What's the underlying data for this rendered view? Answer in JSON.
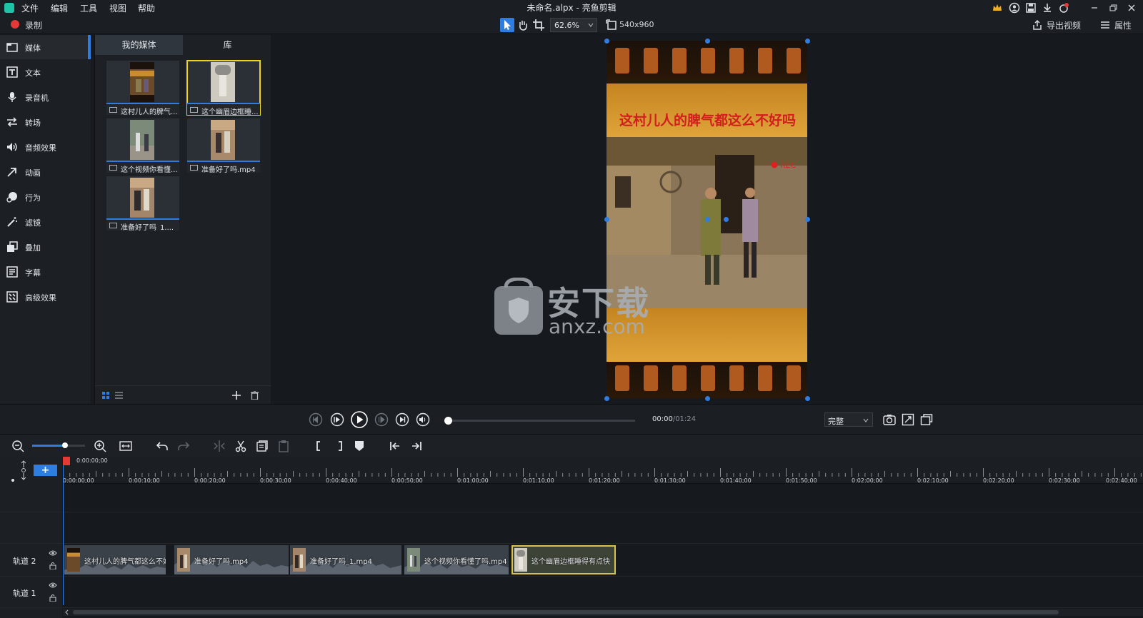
{
  "menubar": {
    "items": [
      "文件",
      "编辑",
      "工具",
      "视图",
      "帮助"
    ],
    "window_title": "未命名.alpx - 亮鱼剪辑"
  },
  "toolbar": {
    "record_label": "录制",
    "zoom_value": "62.6%",
    "resolution": "540x960",
    "export_label": "导出视频",
    "properties_label": "属性"
  },
  "sidebar": {
    "items": [
      {
        "label": "媒体",
        "icon": "media-icon"
      },
      {
        "label": "文本",
        "icon": "text-icon"
      },
      {
        "label": "录音机",
        "icon": "microphone-icon"
      },
      {
        "label": "转场",
        "icon": "transition-icon"
      },
      {
        "label": "音频效果",
        "icon": "speaker-icon"
      },
      {
        "label": "动画",
        "icon": "animation-arrow-icon"
      },
      {
        "label": "行为",
        "icon": "behavior-icon"
      },
      {
        "label": "滤镜",
        "icon": "magic-wand-icon"
      },
      {
        "label": "叠加",
        "icon": "overlay-icon"
      },
      {
        "label": "字幕",
        "icon": "subtitle-icon"
      },
      {
        "label": "高级效果",
        "icon": "advanced-effects-icon"
      }
    ]
  },
  "media": {
    "tabs": [
      "我的媒体",
      "库"
    ],
    "items": [
      {
        "label": "这村儿人的脾气..."
      },
      {
        "label": "这个幽眉边框睡..."
      },
      {
        "label": "这个视频你看懂..."
      },
      {
        "label": "准备好了吗.mp4"
      },
      {
        "label": "准备好了吗_1...."
      }
    ]
  },
  "preview": {
    "video_caption": "这村儿人的脾气都这么不好吗",
    "rec_label": "REC",
    "watermark_text": "安下载",
    "watermark_sub": "anxz.com"
  },
  "playback": {
    "time_current": "00:00",
    "time_total": "/01:24",
    "quality": "完整"
  },
  "timeline": {
    "playhead_time": "0:00:00;00",
    "ticks": [
      "0:00:00;00",
      "0:00:10;00",
      "0:00:20;00",
      "0:00:30;00",
      "0:00:40;00",
      "0:00:50;00",
      "0:01:00;00",
      "0:01:10;00",
      "0:01:20;00",
      "0:01:30;00",
      "0:01:40;00",
      "0:01:50;00",
      "0:02:00;00",
      "0:02:10;00",
      "0:02:20;00",
      "0:02:30;00",
      "0:02:40;00"
    ],
    "tracks": [
      {
        "name": "轨道 2"
      },
      {
        "name": "轨道 1"
      }
    ],
    "clips": [
      {
        "label": "这村儿人的脾气都这么不好"
      },
      {
        "label": "准备好了吗.mp4"
      },
      {
        "label": "准备好了吗_1.mp4"
      },
      {
        "label": "这个视频你看懂了吗.mp4"
      },
      {
        "label": "这个幽眉边框睡得有点快"
      }
    ]
  },
  "colors": {
    "accent": "#2f7de1",
    "record": "#e53935",
    "selected_outline": "#f0d21e"
  }
}
